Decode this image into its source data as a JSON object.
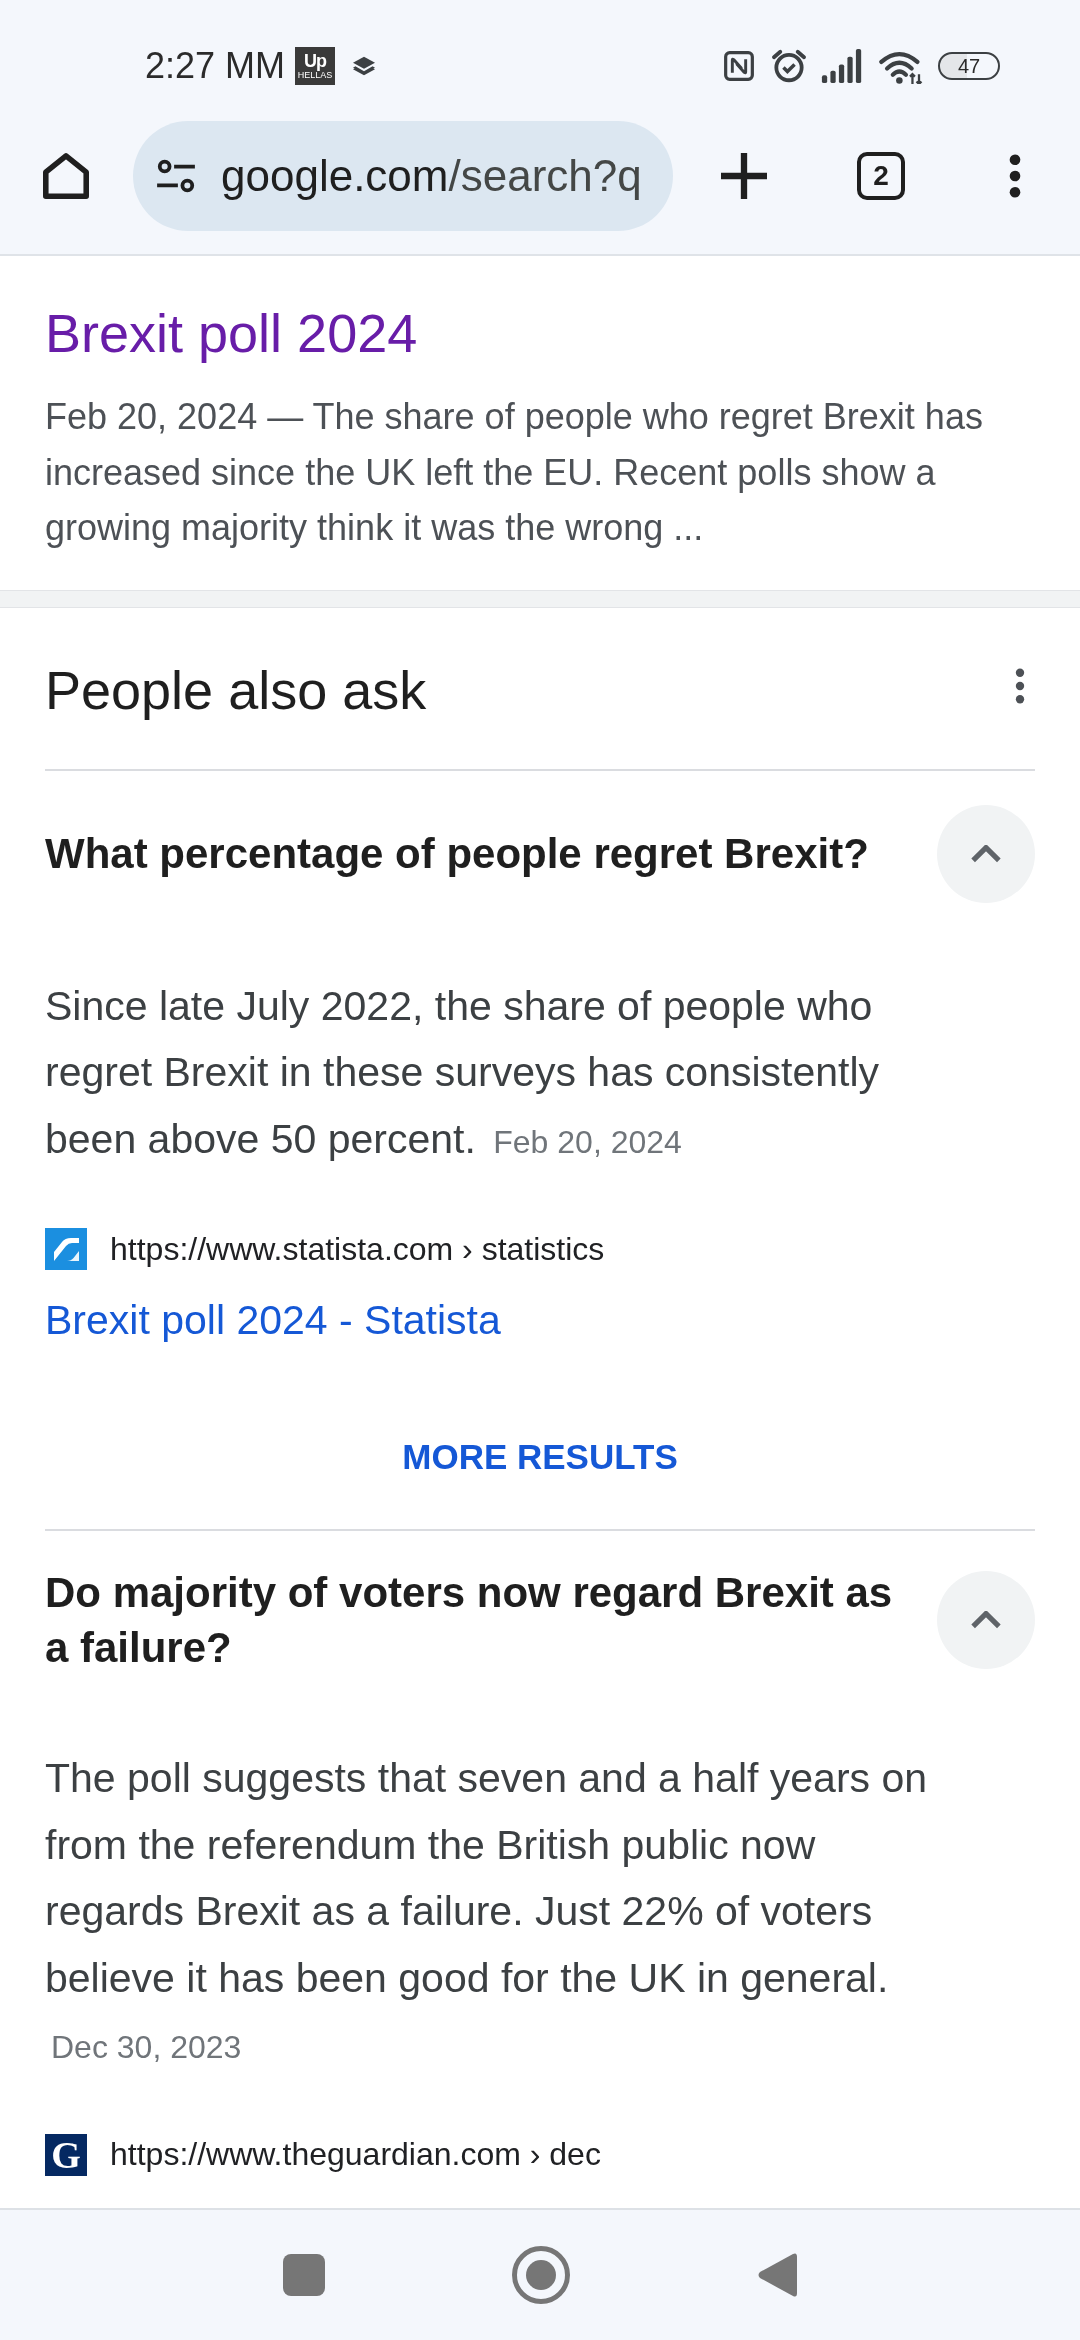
{
  "status_bar": {
    "time": "2:27 MM",
    "notifications": [
      {
        "kind": "app",
        "label": "Up",
        "sublabel": "HELLAS"
      },
      {
        "kind": "layers"
      }
    ],
    "battery": "47"
  },
  "toolbar": {
    "url_domain": "google.com",
    "url_path": "/search?q",
    "tab_count": "2"
  },
  "result": {
    "title": "Brexit poll 2024",
    "visited": true,
    "snippet_lines": [
      "Feb 20, 2024 — The share of people who regret Brexit has",
      "increased since the UK left the EU. Recent polls show a",
      "growing majority think it was the wrong ..."
    ]
  },
  "people_also_ask": {
    "title": "People also ask",
    "questions": [
      {
        "question": "What percentage of people regret Brexit?",
        "expanded": true,
        "answer_lines": [
          "Since late July 2022, the share of people who",
          "regret Brexit in these surveys has consistently",
          "been above 50 percent."
        ],
        "date": "Feb 20, 2024",
        "source": {
          "favicon": {
            "kind": "mark"
          },
          "url": "https://www.statista.com › statistics"
        },
        "link": {
          "text": "Brexit poll 2024 - Statista",
          "visited": false
        },
        "more_results": "MORE RESULTS"
      },
      {
        "question": "Do majority of voters now regard Brexit as a failure?",
        "expanded": true,
        "answer_lines": [
          "The poll suggests that seven and a half years on",
          "from the referendum the British public now",
          "regards Brexit as a failure. Just 22% of voters",
          "believe it has been good for the UK in general."
        ],
        "date": "Dec 30, 2023",
        "source": {
          "favicon": {
            "kind": "letter",
            "letter": "G"
          },
          "url": "https://www.theguardian.com › dec"
        }
      }
    ]
  }
}
